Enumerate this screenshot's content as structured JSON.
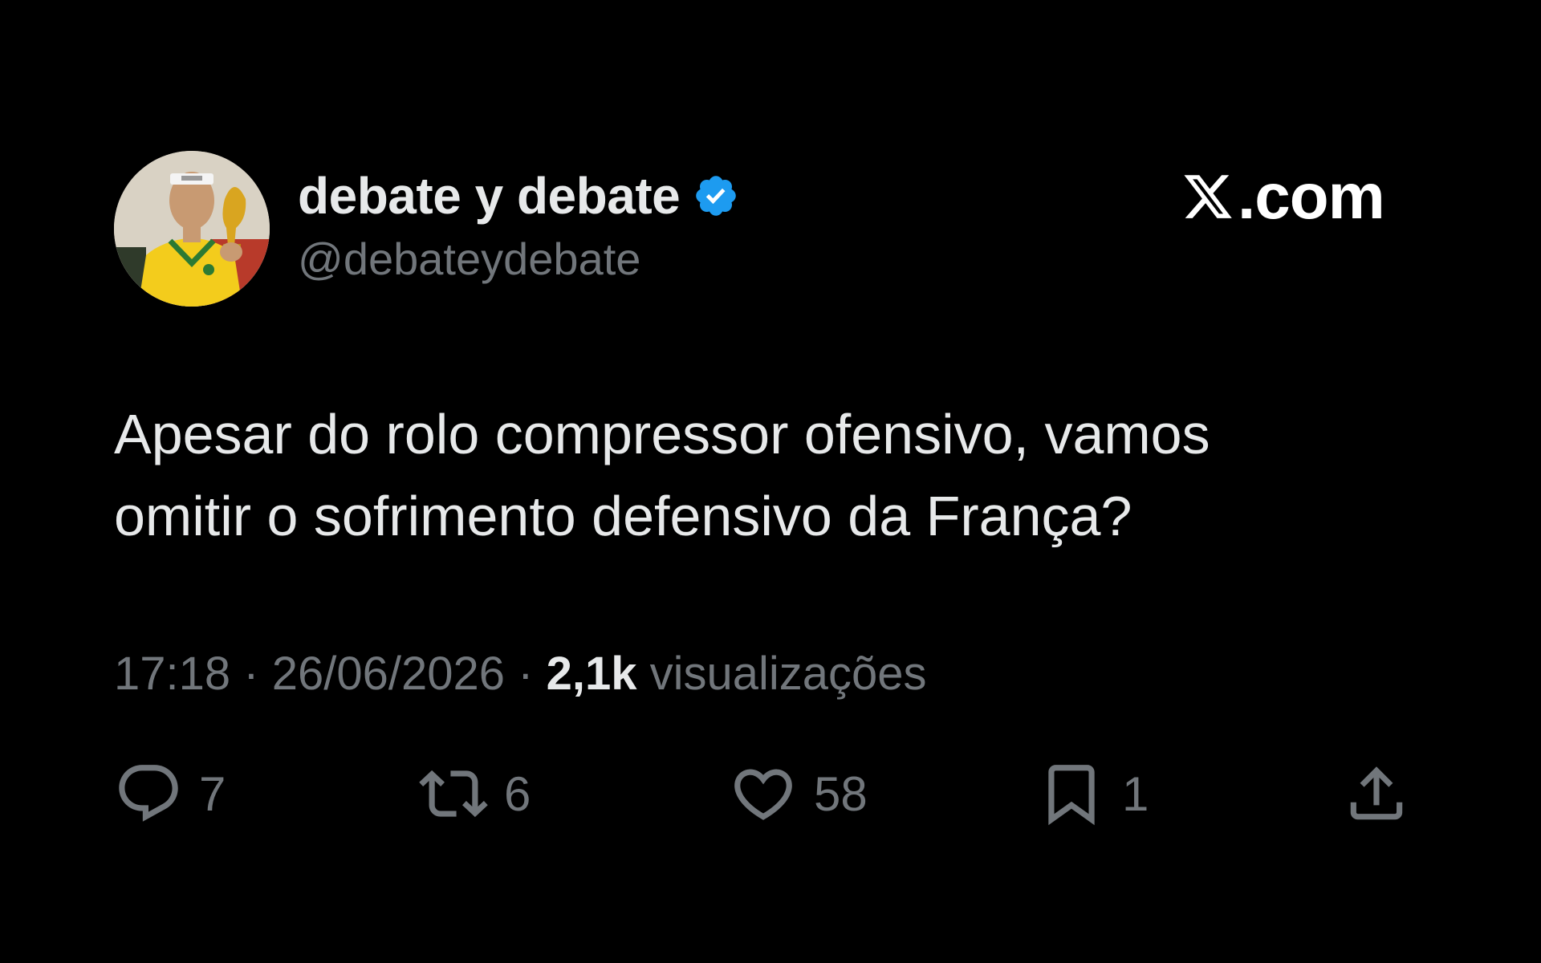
{
  "author": {
    "display_name": "debate y debate",
    "handle": "@debateydebate",
    "verified": true,
    "verified_color": "#1d9bf0",
    "avatar_icon": "avatar-illustration"
  },
  "brand": {
    "logo_icon": "x-logo-icon",
    "text": ".com"
  },
  "tweet": {
    "text_lines": [
      "Apesar do rolo compressor ofensivo, vamos",
      "omitir o sofrimento defensivo da França?"
    ],
    "time": "17:18",
    "separator": "·",
    "date": "26/06/2026",
    "views_count": "2,1k",
    "views_label": "visualizações"
  },
  "actions": {
    "reply": {
      "icon": "reply-icon",
      "count": "7"
    },
    "retweet": {
      "icon": "retweet-icon",
      "count": "6"
    },
    "like": {
      "icon": "heart-icon",
      "count": "58"
    },
    "bookmark": {
      "icon": "bookmark-icon",
      "count": "1"
    },
    "share": {
      "icon": "share-icon"
    }
  },
  "colors": {
    "background": "#000000",
    "primary_text": "#e7e9ea",
    "secondary_text": "#71767b"
  }
}
